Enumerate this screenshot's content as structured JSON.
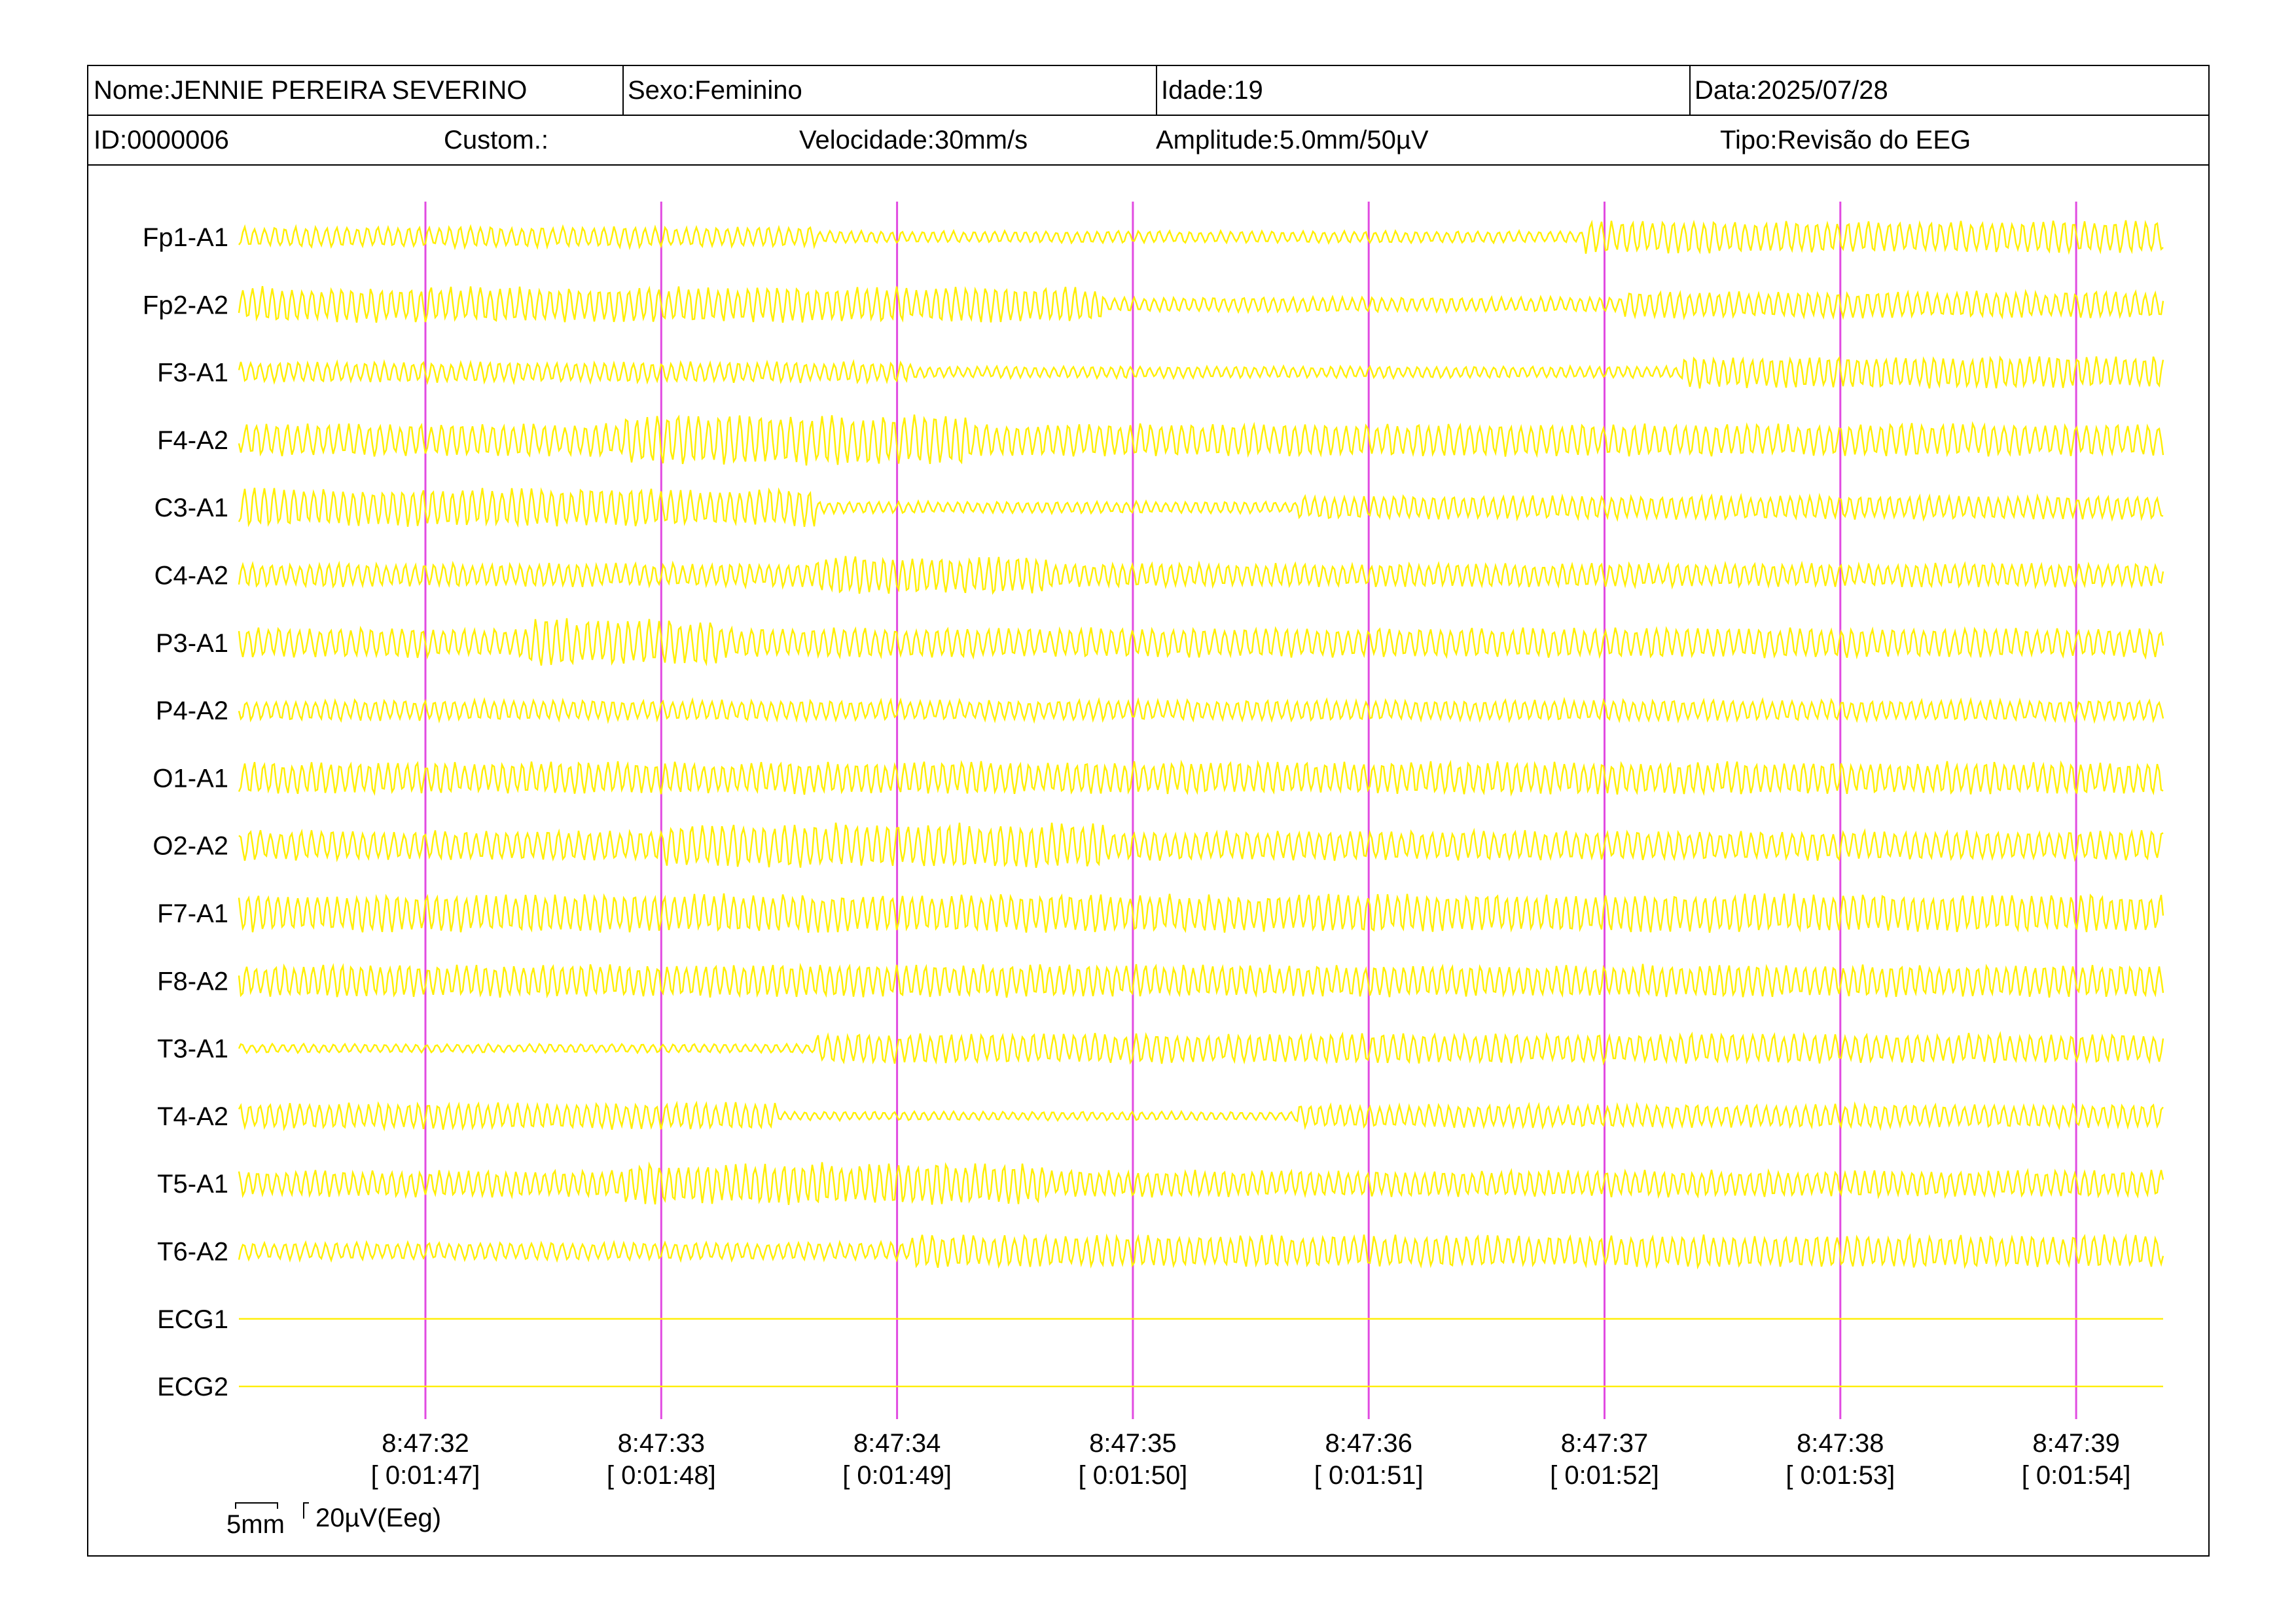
{
  "header": {
    "name": "Nome:JENNIE PEREIRA SEVERINO",
    "sex": "Sexo:Feminino",
    "age": "Idade:19",
    "date": "Data:2025/07/28",
    "id": "ID:0000006",
    "custom": "Custom.:",
    "speed": "Velocidade:30mm/s",
    "amplitude": "Amplitude:5.0mm/50µV",
    "type": "Tipo:Revisão do EEG"
  },
  "colors": {
    "trace": "#ffee00",
    "marker": "#e14be1",
    "frame": "#000000",
    "background": "#ffffff"
  },
  "chart_data": {
    "type": "line",
    "channels": [
      "Fp1-A1",
      "Fp2-A2",
      "F3-A1",
      "F4-A2",
      "C3-A1",
      "C4-A2",
      "P3-A1",
      "P4-A2",
      "O1-A1",
      "O2-A2",
      "F7-A1",
      "F8-A2",
      "T3-A1",
      "T4-A2",
      "T5-A1",
      "T6-A2",
      "ECG1",
      "ECG2"
    ],
    "x_ticks": [
      {
        "time": "8:47:32",
        "elapsed": "[ 0:01:47]"
      },
      {
        "time": "8:47:33",
        "elapsed": "[ 0:01:48]"
      },
      {
        "time": "8:47:34",
        "elapsed": "[ 0:01:49]"
      },
      {
        "time": "8:47:35",
        "elapsed": "[ 0:01:50]"
      },
      {
        "time": "8:47:36",
        "elapsed": "[ 0:01:51]"
      },
      {
        "time": "8:47:37",
        "elapsed": "[ 0:01:52]"
      },
      {
        "time": "8:47:38",
        "elapsed": "[ 0:01:53]"
      },
      {
        "time": "8:47:39",
        "elapsed": "[ 0:01:54]"
      }
    ],
    "grid": false,
    "legend": "none"
  },
  "scale": {
    "time_label": "5mm",
    "amp_label": "20µV(Eeg)"
  }
}
